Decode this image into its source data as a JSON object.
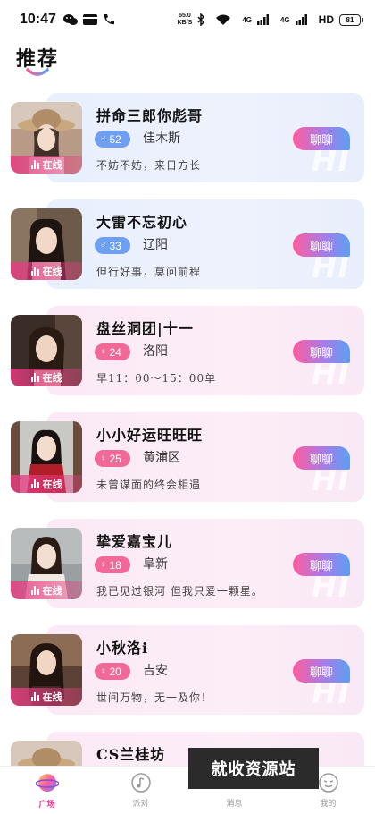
{
  "status_bar": {
    "time": "10:47",
    "net_speed_value": "55.0",
    "net_speed_unit": "KB/S",
    "signal_label_1": "4G",
    "signal_label_2": "4G",
    "hd_label": "HD",
    "battery": "81"
  },
  "header": {
    "title": "推荐"
  },
  "colors": {
    "accent_pink": "#e8388a",
    "male_badge": "#6f9ff0",
    "female_badge": "#f16a97"
  },
  "users": [
    {
      "name": "拼命三郎你彪哥",
      "age": "52",
      "gender": "male",
      "city": "佳木斯",
      "signature": "不妨不妨，来日方长",
      "online": "在线",
      "chat": "聊聊",
      "theme": "blue",
      "hi": "HI"
    },
    {
      "name": "大雷不忘初心",
      "age": "33",
      "gender": "male",
      "city": "辽阳",
      "signature": "但行好事，莫问前程",
      "online": "在线",
      "chat": "聊聊",
      "theme": "blue",
      "hi": "HI"
    },
    {
      "name": "盘丝洞团|十一",
      "age": "24",
      "gender": "female",
      "city": "洛阳",
      "signature": "早11：00～15：00单",
      "online": "在线",
      "chat": "聊聊",
      "theme": "pink",
      "hi": "HI"
    },
    {
      "name": "小小好运旺旺旺",
      "age": "25",
      "gender": "female",
      "city": "黄浦区",
      "signature": "未曾谋面的终会相遇",
      "online": "在线",
      "chat": "聊聊",
      "theme": "pink",
      "hi": "HI"
    },
    {
      "name": "挚爱嘉宝儿",
      "age": "18",
      "gender": "female",
      "city": "阜新",
      "signature": "我已见过银河 但我只爱一颗星。",
      "online": "在线",
      "chat": "聊聊",
      "theme": "pink",
      "hi": "HI"
    },
    {
      "name": "小秋洛i",
      "age": "20",
      "gender": "female",
      "city": "吉安",
      "signature": "世间万物，无一及你！",
      "online": "在线",
      "chat": "聊聊",
      "theme": "pink",
      "hi": "HI"
    },
    {
      "name": "CS兰桂坊",
      "theme": "pink"
    }
  ],
  "bottom_nav": {
    "items": [
      {
        "label": "广场",
        "icon": "planet-icon",
        "active": true
      },
      {
        "label": "派对",
        "icon": "music-note-icon",
        "active": false
      },
      {
        "label": "消息",
        "icon": "message-icon",
        "active": false
      },
      {
        "label": "我的",
        "icon": "profile-face-icon",
        "active": false
      }
    ]
  },
  "watermark": {
    "text": "就收资源站"
  }
}
